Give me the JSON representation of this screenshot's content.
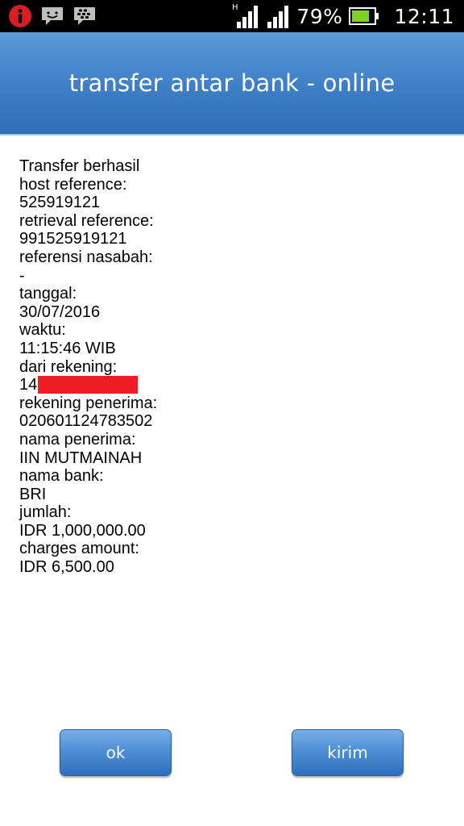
{
  "status_bar": {
    "network_type": "H",
    "battery_percent": "79%",
    "battery_level": 0.79,
    "clock": "12:11",
    "colors": {
      "notification_red": "#d81e25",
      "battery_green": "#7ed321"
    }
  },
  "header": {
    "title": "transfer antar bank - online"
  },
  "receipt": {
    "lines": [
      "Transfer berhasil",
      "host reference:",
      "525919121",
      "retrieval reference:",
      "991525919121",
      "referensi nasabah:",
      "-",
      "tanggal:",
      "30/07/2016",
      "waktu:",
      "11:15:46 WIB",
      "dari rekening:",
      "14",
      "rekening penerima:",
      "020601124783502",
      "nama penerima:",
      "IIN MUTMAINAH",
      "nama bank:",
      "BRI",
      "jumlah:",
      "IDR 1,000,000.00",
      "charges amount:",
      "IDR 6,500.00"
    ],
    "redaction_color": "#ee1c25"
  },
  "buttons": {
    "ok_label": "ok",
    "kirim_label": "kirim"
  }
}
